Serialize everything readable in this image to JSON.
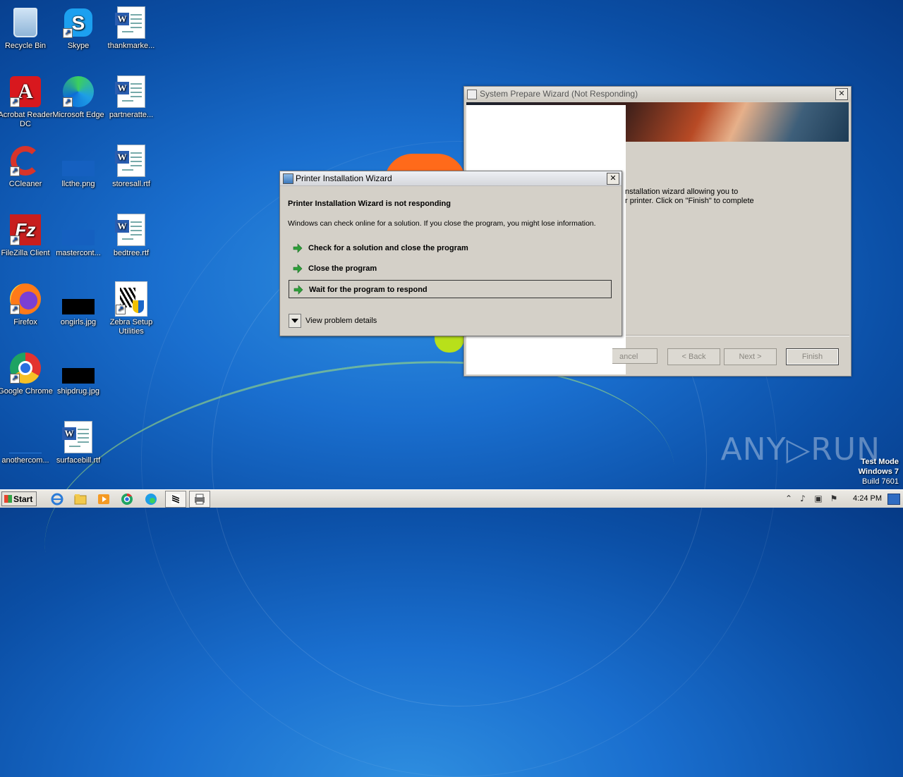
{
  "desktop": {
    "icons": [
      {
        "label": "Recycle Bin"
      },
      {
        "label": "Skype"
      },
      {
        "label": "thankmarke..."
      },
      {
        "label": "Acrobat Reader DC"
      },
      {
        "label": "Microsoft Edge"
      },
      {
        "label": "partneratte..."
      },
      {
        "label": "CCleaner"
      },
      {
        "label": "llcthe.png"
      },
      {
        "label": "storesall.rtf"
      },
      {
        "label": "FileZilla Client"
      },
      {
        "label": "mastercont..."
      },
      {
        "label": "bedtree.rtf"
      },
      {
        "label": "Firefox"
      },
      {
        "label": "ongirls.jpg"
      },
      {
        "label": "Zebra Setup Utilities"
      },
      {
        "label": "Google Chrome"
      },
      {
        "label": "shipdrug.jpg"
      },
      {
        "label": "anothercom..."
      },
      {
        "label": "surfacebill.rtf"
      }
    ]
  },
  "background_window": {
    "title": "System Prepare Wizard (Not Responding)",
    "close_label": "✕",
    "body_line1": "nstallation wizard allowing you to",
    "body_line2": "r printer. Click on \"Finish\" to complete",
    "buttons": {
      "cancel": "ancel",
      "back": "< Back",
      "next": "Next >",
      "finish": "Finish"
    }
  },
  "dialog": {
    "title": "Printer Installation Wizard",
    "close_label": "✕",
    "heading": "Printer Installation Wizard is not responding",
    "description": "Windows can check online for a solution. If you close the program, you might lose information.",
    "options": [
      {
        "label": "Check for a solution and close the program"
      },
      {
        "label": "Close the program"
      },
      {
        "label": "Wait for the program to respond"
      }
    ],
    "details_label": "View problem details"
  },
  "watermark": "ANY▷RUN",
  "system_info": {
    "line1": "Test Mode",
    "line2": "Windows 7",
    "line3": "Build 7601"
  },
  "taskbar": {
    "start_label": "Start",
    "clock": "4:24 PM"
  },
  "colors": {
    "desktop": "#1a6fcf",
    "option_arrow": "#2e9e3a",
    "dialog_bg": "#d4d0c8"
  }
}
